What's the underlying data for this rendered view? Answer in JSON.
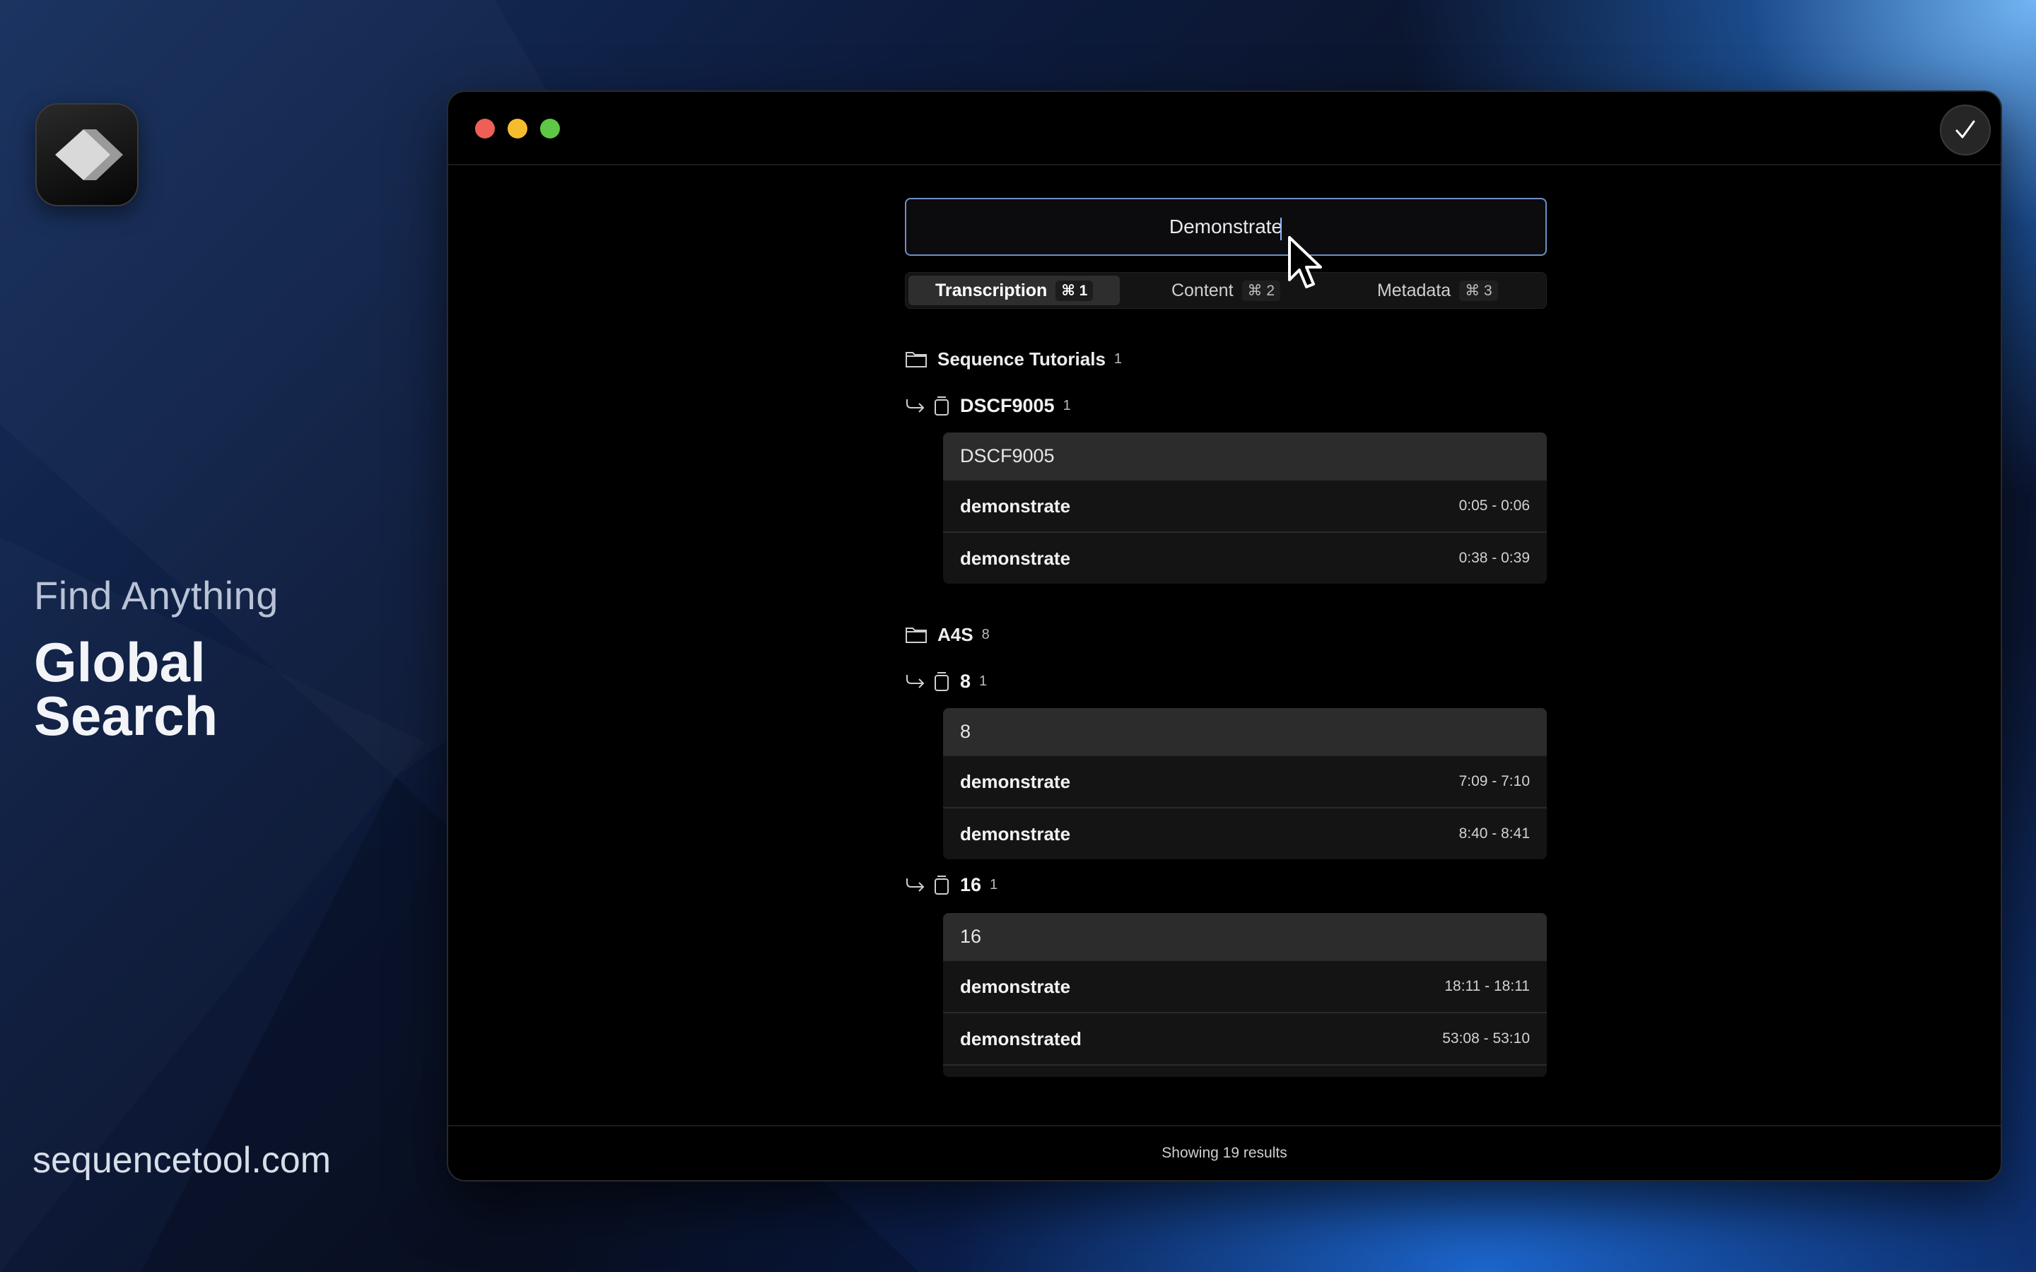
{
  "promo": {
    "tagline_sub": "Find Anything",
    "tagline_main": "Global Search",
    "website": "sequencetool.com"
  },
  "search": {
    "value": "Demonstrate"
  },
  "tabs": [
    {
      "label": "Transcription",
      "shortcut": "⌘ 1",
      "active": true
    },
    {
      "label": "Content",
      "shortcut": "⌘ 2",
      "active": false
    },
    {
      "label": "Metadata",
      "shortcut": "⌘ 3",
      "active": false
    }
  ],
  "results": {
    "folders": [
      {
        "name": "Sequence Tutorials",
        "count": "1",
        "clips": [
          {
            "name": "DSCF9005",
            "count": "1",
            "header": "DSCF9005",
            "matches": [
              {
                "word": "demonstrate",
                "time": "0:05 - 0:06"
              },
              {
                "word": "demonstrate",
                "time": "0:38 - 0:39"
              }
            ]
          }
        ]
      },
      {
        "name": "A4S",
        "count": "8",
        "clips": [
          {
            "name": "8",
            "count": "1",
            "header": "8",
            "matches": [
              {
                "word": "demonstrate",
                "time": "7:09 - 7:10"
              },
              {
                "word": "demonstrate",
                "time": "8:40 - 8:41"
              }
            ]
          },
          {
            "name": "16",
            "count": "1",
            "header": "16",
            "matches": [
              {
                "word": "demonstrate",
                "time": "18:11 - 18:11"
              },
              {
                "word": "demonstrated",
                "time": "53:08 - 53:10"
              }
            ]
          }
        ]
      }
    ]
  },
  "footer": {
    "status": "Showing 19 results"
  },
  "colors": {
    "accent_border": "#6e8fc4",
    "close": "#ee5f57",
    "minimize": "#f5bd2e",
    "maximize": "#5fc745"
  }
}
